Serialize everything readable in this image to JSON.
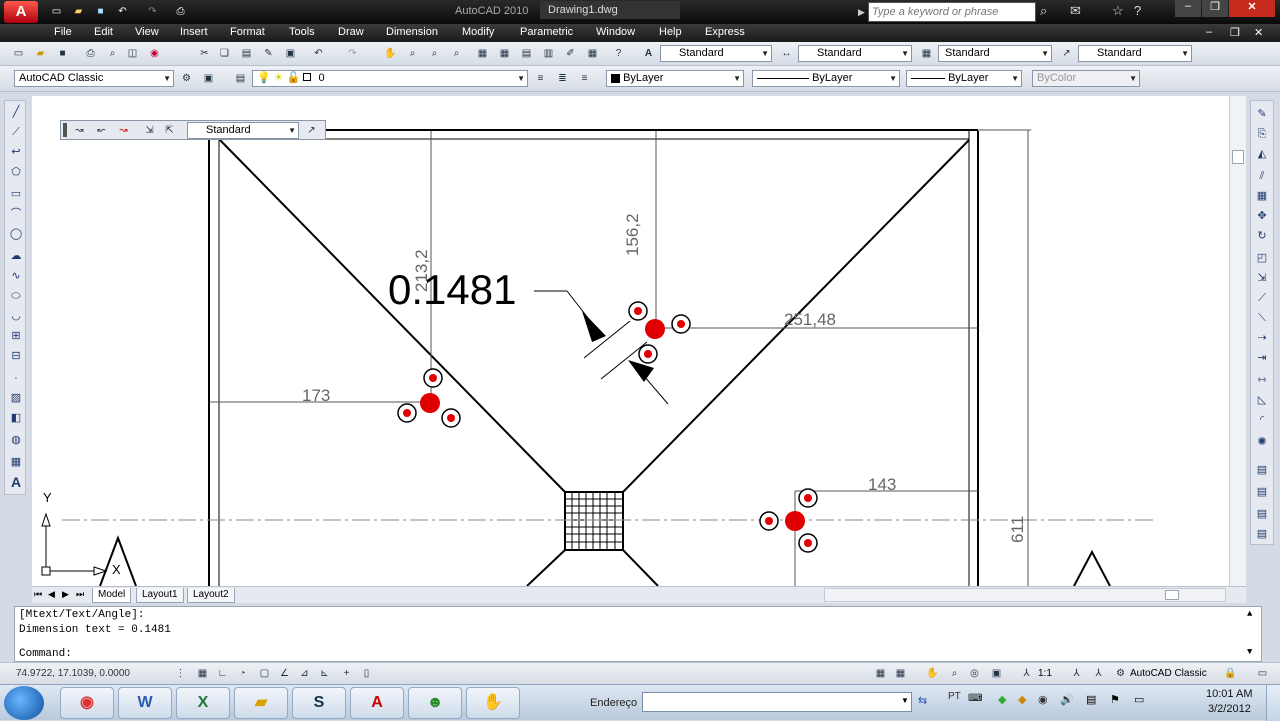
{
  "titlebar": {
    "app_title": "AutoCAD 2010",
    "document": "Drawing1.dwg",
    "search_placeholder": "Type a keyword or phrase"
  },
  "menus": [
    "File",
    "Edit",
    "View",
    "Insert",
    "Format",
    "Tools",
    "Draw",
    "Dimension",
    "Modify",
    "Parametric",
    "Window",
    "Help",
    "Express"
  ],
  "styles": {
    "text_style": "Standard",
    "dim_style": "Standard",
    "table_style": "Standard",
    "mleader_style": "Standard"
  },
  "workspace": "AutoCAD Classic",
  "layer": "0",
  "color": "ByLayer",
  "linetype": "ByLayer",
  "lineweight": "ByLayer",
  "plotstyle": "ByColor",
  "dimbar_style": "Standard",
  "drawing": {
    "big_text": "0.1481",
    "dims": [
      "156,2",
      "213,2",
      "251,48",
      "173",
      "143",
      "611"
    ],
    "ucs_x": "X",
    "ucs_y": "Y"
  },
  "tabs": [
    "Model",
    "Layout1",
    "Layout2"
  ],
  "command": {
    "line1": "[Mtext/Text/Angle]:",
    "line2": "Dimension text = 0.1481",
    "prompt": "Command:"
  },
  "status": {
    "coords": "74.9722, 17.1039, 0.0000",
    "scale": "1:1",
    "workspace": "AutoCAD Classic"
  },
  "taskbar": {
    "address_label": "Endereço",
    "lang": "PT",
    "time": "10:01 AM",
    "date": "3/2/2012"
  },
  "colors": {
    "accent_red": "#e8141c",
    "grip_red": "#e00000",
    "drawing_line": "#000000",
    "dim_gray": "#555555"
  }
}
